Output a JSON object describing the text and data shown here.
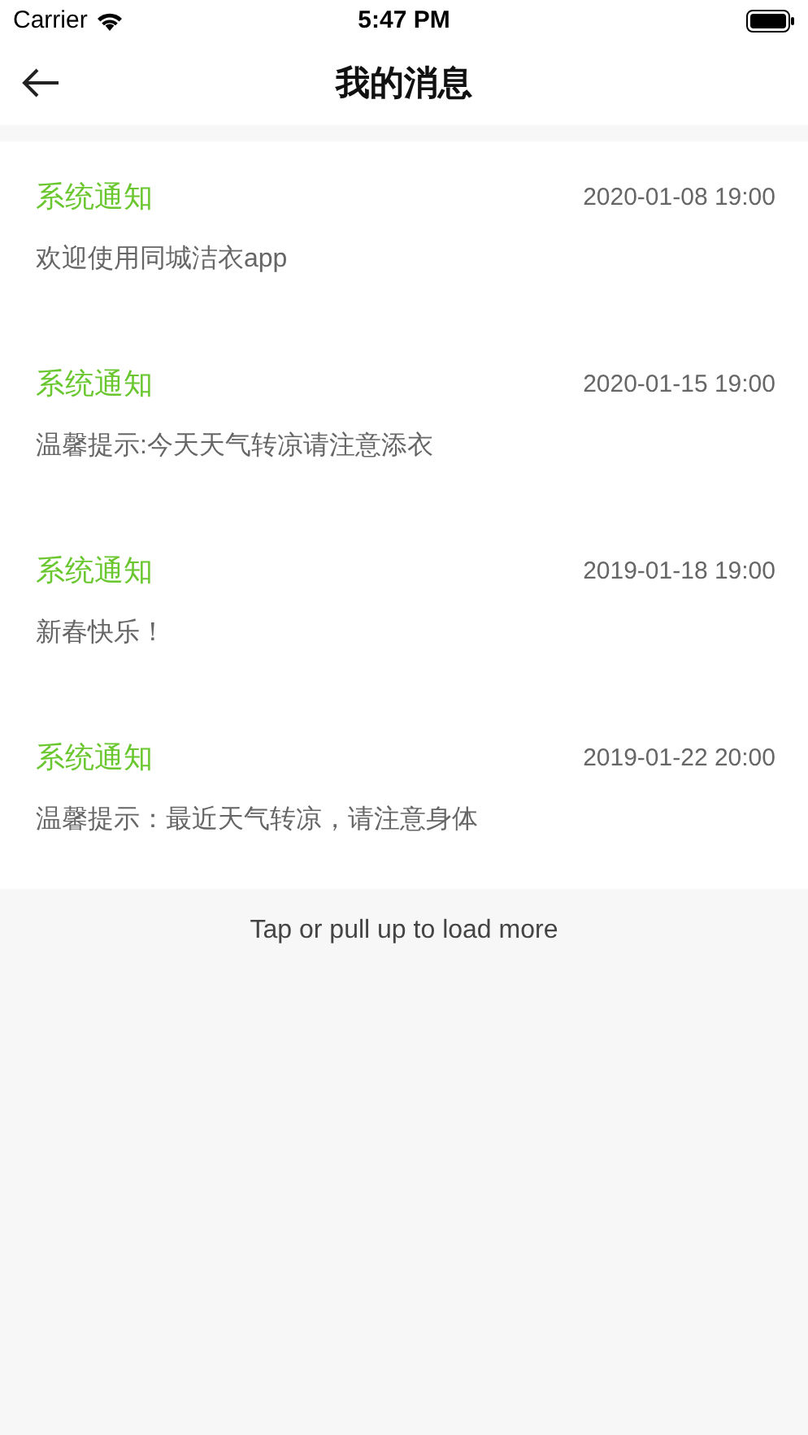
{
  "status_bar": {
    "carrier": "Carrier",
    "time": "5:47 PM"
  },
  "nav": {
    "title": "我的消息"
  },
  "messages": [
    {
      "title": "系统通知",
      "date": "2020-01-08 19:00",
      "body": "欢迎使用同城洁衣app"
    },
    {
      "title": "系统通知",
      "date": "2020-01-15 19:00",
      "body": "温馨提示:今天天气转凉请注意添衣"
    },
    {
      "title": "系统通知",
      "date": "2019-01-18 19:00",
      "body": "新春快乐！"
    },
    {
      "title": "系统通知",
      "date": "2019-01-22 20:00",
      "body": "温馨提示：最近天气转凉，请注意身体"
    }
  ],
  "load_more": "Tap or pull up to load more"
}
